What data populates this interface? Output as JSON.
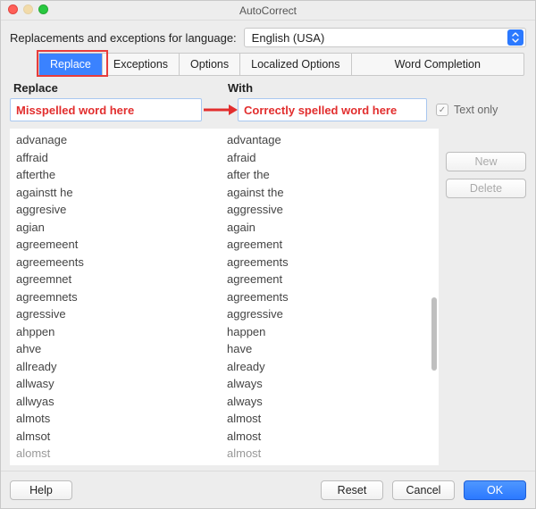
{
  "window": {
    "title": "AutoCorrect"
  },
  "lang": {
    "label": "Replacements and exceptions for language:",
    "value": "English (USA)"
  },
  "tabs": {
    "replace": "Replace",
    "exceptions": "Exceptions",
    "options": "Options",
    "localized": "Localized Options",
    "wordcompletion": "Word Completion",
    "active_index": 0
  },
  "columns": {
    "replace": "Replace",
    "with": "With"
  },
  "fields": {
    "replace_placeholder": "Misspelled word here",
    "with_placeholder": "Correctly spelled word here"
  },
  "checkbox": {
    "text_only_label": "Text only",
    "text_only_checked": true
  },
  "side_buttons": {
    "new": "New",
    "delete": "Delete"
  },
  "footer": {
    "help": "Help",
    "reset": "Reset",
    "cancel": "Cancel",
    "ok": "OK"
  },
  "annotation": {
    "highlight_color": "#e73c3c",
    "arrow_color": "#e22e2e"
  },
  "entries": [
    {
      "from": "advanage",
      "to": "advantage"
    },
    {
      "from": "affraid",
      "to": "afraid"
    },
    {
      "from": "afterthe",
      "to": "after the"
    },
    {
      "from": "againstt he",
      "to": "against the"
    },
    {
      "from": "aggresive",
      "to": "aggressive"
    },
    {
      "from": "agian",
      "to": "again"
    },
    {
      "from": "agreemeent",
      "to": "agreement"
    },
    {
      "from": "agreemeents",
      "to": "agreements"
    },
    {
      "from": "agreemnet",
      "to": "agreement"
    },
    {
      "from": "agreemnets",
      "to": "agreements"
    },
    {
      "from": "agressive",
      "to": "aggressive"
    },
    {
      "from": "ahppen",
      "to": "happen"
    },
    {
      "from": "ahve",
      "to": "have"
    },
    {
      "from": "allready",
      "to": "already"
    },
    {
      "from": "allwasy",
      "to": "always"
    },
    {
      "from": "allwyas",
      "to": "always"
    },
    {
      "from": "almots",
      "to": "almost"
    },
    {
      "from": "almsot",
      "to": "almost"
    },
    {
      "from": "alomst",
      "to": "almost"
    }
  ],
  "scroll": {
    "thumb_top_pct": 50,
    "thumb_height_pct": 22
  }
}
